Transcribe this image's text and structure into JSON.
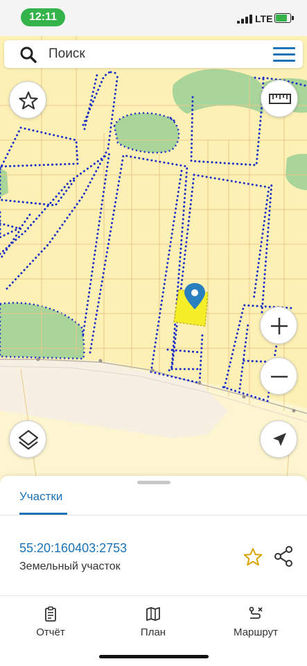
{
  "status_bar": {
    "time": "12:11",
    "network": "LTE",
    "colors": {
      "time_pill": "#34b34a",
      "battery": "#34b34a"
    }
  },
  "search": {
    "placeholder": "Поиск",
    "search_icon": "search-icon",
    "menu_icon": "hamburger-menu-icon"
  },
  "map": {
    "colors": {
      "background": "#fcf0b5",
      "grid": "#e7c98a",
      "boundary": "#1c2fc7",
      "forest": "#a9d49a",
      "road": "#f6efe2",
      "selected_parcel": "#f5ef2a",
      "pin": "#2a7fbf"
    },
    "controls": {
      "favorite_icon": "star-outline-icon",
      "ruler_icon": "ruler-icon",
      "zoom_in_icon": "plus-icon",
      "zoom_out_icon": "minus-icon",
      "layers_icon": "layers-icon",
      "locate_icon": "navigation-arrow-icon"
    }
  },
  "panel": {
    "tab_label": "Участки",
    "parcel": {
      "cadastral_number": "55:20:160403:2753",
      "type": "Земельный участок",
      "favorite_icon": "star-outline-icon",
      "share_icon": "share-icon"
    }
  },
  "bottom_nav": [
    {
      "label": "Отчёт",
      "icon": "report-icon"
    },
    {
      "label": "План",
      "icon": "map-icon"
    },
    {
      "label": "Маршрут",
      "icon": "route-icon"
    }
  ],
  "accent_color": "#1a73b8"
}
